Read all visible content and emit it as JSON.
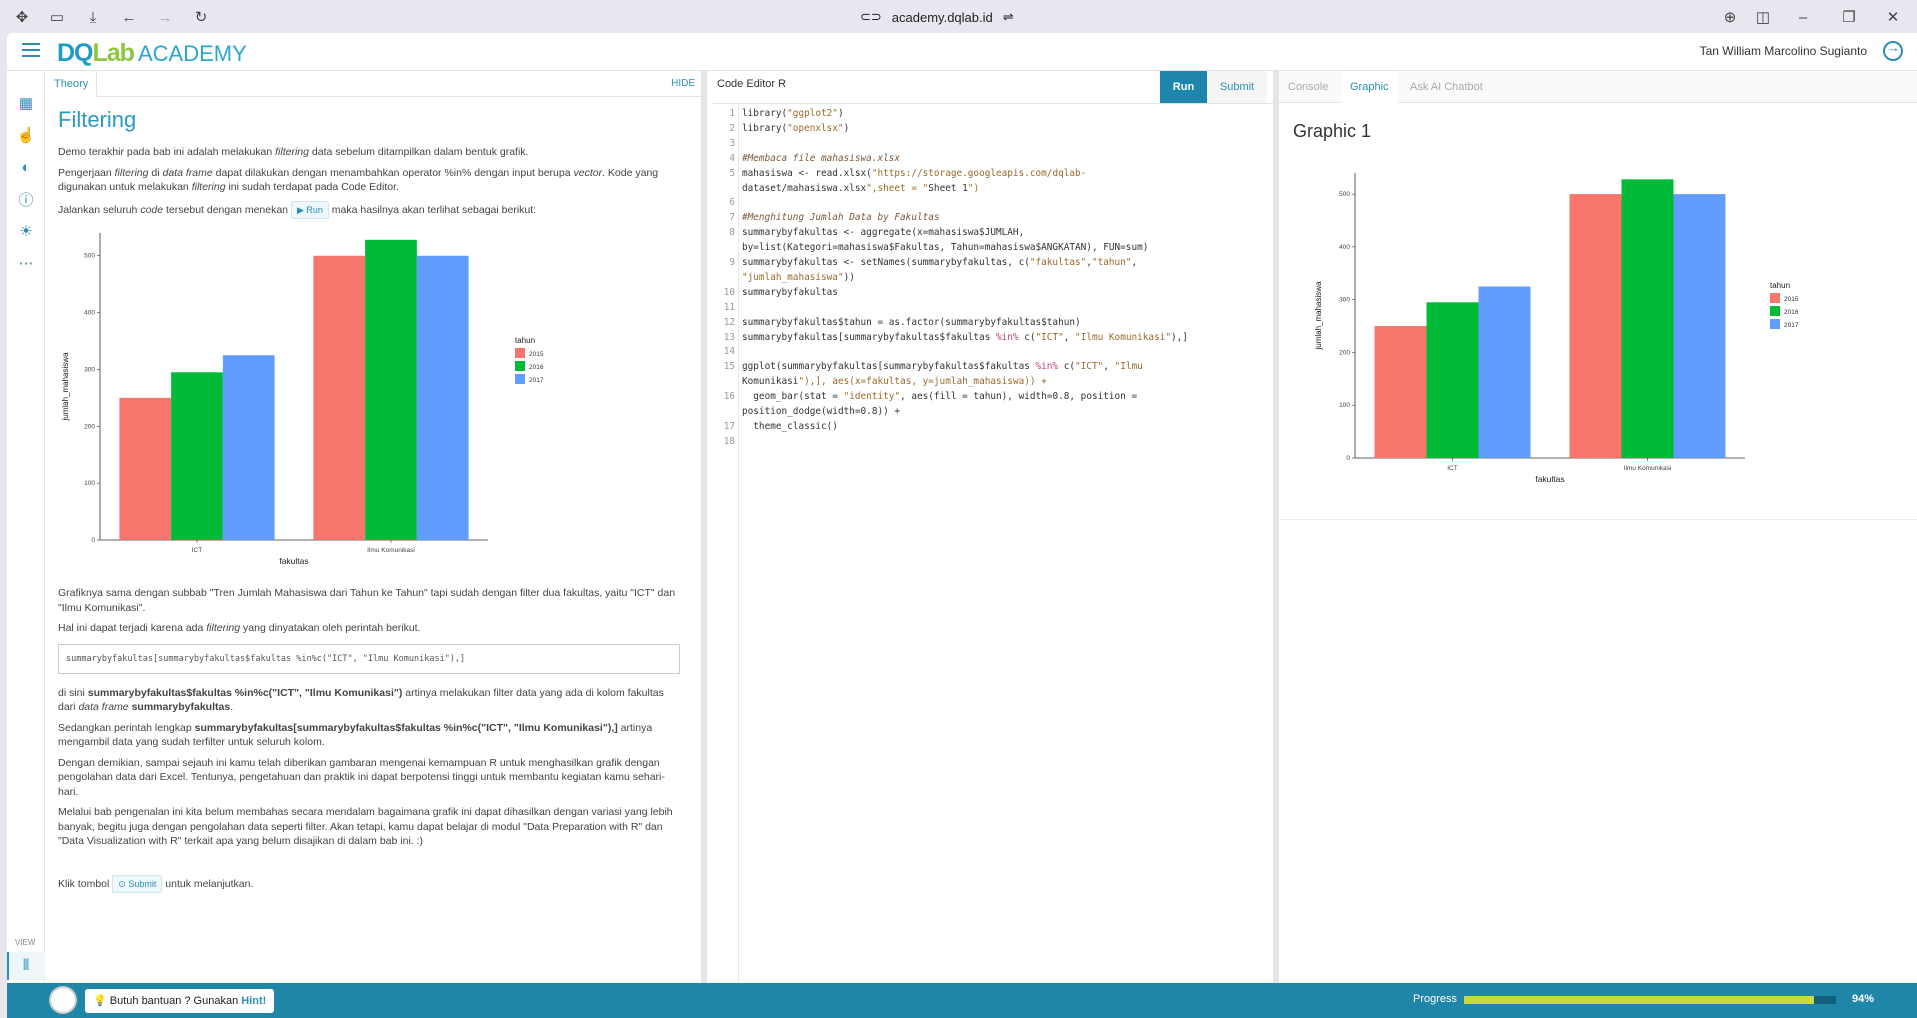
{
  "browser": {
    "url": "academy.dqlab.id"
  },
  "header": {
    "logo_dq": "DQ",
    "logo_lab": "Lab",
    "logo_academy": "ACADEMY",
    "user_name": "Tan William Marcolino Sugianto"
  },
  "rail": {
    "view_label": "VIEW"
  },
  "theory": {
    "tab_label": "Theory",
    "hide_label": "HIDE",
    "title": "Filtering",
    "p1_a": "Demo terakhir pada bab ini adalah melakukan ",
    "p1_em": "filtering",
    "p1_b": " data sebelum ditampilkan dalam bentuk grafik.",
    "p2_a": "Pengerjaan ",
    "p2_em1": "filtering",
    "p2_b": " di ",
    "p2_em2": "data frame",
    "p2_c": " dapat dilakukan dengan menambahkan operator %in% dengan input berupa ",
    "p2_em3": "vector",
    "p2_d": ". Kode yang digunakan untuk melakukan ",
    "p2_em4": "filtering",
    "p2_e": " ini sudah terdapat pada Code Editor.",
    "p3_a": "Jalankan seluruh ",
    "p3_em": "code",
    "p3_b": " tersebut dengan menekan ",
    "p3_btn": "Run",
    "p3_c": " maka hasilnya akan terlihat sebagai berikut:",
    "p4": "Grafiknya sama dengan subbab \"Tren Jumlah Mahasiswa dari Tahun ke Tahun\" tapi sudah dengan filter dua fakultas, yaitu \"ICT\" dan \"Ilmu Komunikasi\".",
    "p5_a": "Hal ini dapat terjadi karena ada ",
    "p5_em": "filtering",
    "p5_b": " yang dinyatakan oleh perintah berikut.",
    "code_snippet": "summarybyfakultas[summarybyfakultas$fakultas %in%c(\"ICT\", \"Ilmu Komunikasi\"),]",
    "p6_a": "di sini ",
    "p6_b1": "summarybyfakultas$fakultas %in%c(\"ICT\", \"Ilmu Komunikasi\")",
    "p6_c": " artinya melakukan filter data yang ada di kolom fakultas dari ",
    "p6_em": "data frame",
    "p6_d": " ",
    "p6_b2": "summarybyfakultas",
    "p6_e": ".",
    "p7_a": "Sedangkan perintah lengkap ",
    "p7_b": "summarybyfakultas[summarybyfakultas$fakultas %in%c(\"ICT\", \"Ilmu Komunikasi\"),]",
    "p7_c": " artinya mengambil data yang sudah terfilter untuk seluruh kolom.",
    "p8": "Dengan demikian, sampai sejauh ini kamu telah diberikan gambaran mengenai kemampuan R untuk menghasilkan grafik dengan pengolahan data dari Excel. Tentunya, pengetahuan dan praktik ini dapat berpotensi tinggi untuk membantu kegiatan kamu sehari-hari.",
    "p9": "Melalui bab pengenalan ini kita belum membahas secara mendalam bagaimana grafik ini dapat dihasilkan dengan variasi yang lebih banyak, begitu juga dengan pengolahan data seperti filter. Akan tetapi, kamu dapat belajar di modul \"Data Preparation with R\" dan \"Data Visualization with R\" terkait apa yang belum disajikan di dalam bab ini. :)",
    "p10_a": "Klik tombol ",
    "p10_btn": "Submit",
    "p10_b": " untuk melanjutkan."
  },
  "editor": {
    "tab_label": "Code Editor R",
    "run_label": "Run",
    "submit_label": "Submit",
    "lines": [
      {
        "n": "1",
        "t": "library(\"ggplot2\")"
      },
      {
        "n": "2",
        "t": "library(\"openxlsx\")"
      },
      {
        "n": "3",
        "t": ""
      },
      {
        "n": "4",
        "t": "#Membaca file mahasiswa.xlsx"
      },
      {
        "n": "5",
        "t": "mahasiswa <- read.xlsx(\"https://storage.googleapis.com/dqlab-"
      },
      {
        "n": "",
        "t": "dataset/mahasiswa.xlsx\",sheet = \"Sheet 1\")"
      },
      {
        "n": "6",
        "t": ""
      },
      {
        "n": "7",
        "t": "#Menghitung Jumlah Data by Fakultas"
      },
      {
        "n": "8",
        "t": "summarybyfakultas <- aggregate(x=mahasiswa$JUMLAH,"
      },
      {
        "n": "",
        "t": "by=list(Kategori=mahasiswa$Fakultas, Tahun=mahasiswa$ANGKATAN), FUN=sum)"
      },
      {
        "n": "9",
        "t": "summarybyfakultas <- setNames(summarybyfakultas, c(\"fakultas\",\"tahun\","
      },
      {
        "n": "",
        "t": "\"jumlah_mahasiswa\"))"
      },
      {
        "n": "10",
        "t": "summarybyfakultas"
      },
      {
        "n": "11",
        "t": ""
      },
      {
        "n": "12",
        "t": "summarybyfakultas$tahun = as.factor(summarybyfakultas$tahun)"
      },
      {
        "n": "13",
        "t": "summarybyfakultas[summarybyfakultas$fakultas %in% c(\"ICT\", \"Ilmu Komunikasi\"),]"
      },
      {
        "n": "14",
        "t": ""
      },
      {
        "n": "15",
        "t": "ggplot(summarybyfakultas[summarybyfakultas$fakultas %in% c(\"ICT\", \"Ilmu"
      },
      {
        "n": "",
        "t": "Komunikasi\"),], aes(x=fakultas, y=jumlah_mahasiswa)) +"
      },
      {
        "n": "16",
        "t": "  geom_bar(stat = \"identity\", aes(fill = tahun), width=0.8, position ="
      },
      {
        "n": "",
        "t": "position_dodge(width=0.8)) +"
      },
      {
        "n": "17",
        "t": "  theme_classic()"
      },
      {
        "n": "18",
        "t": ""
      }
    ]
  },
  "output": {
    "tabs": [
      "Console",
      "Graphic",
      "Ask AI Chatbot"
    ],
    "active_tab": "Graphic",
    "graphic_title": "Graphic 1"
  },
  "footer": {
    "hint_prefix": "Butuh bantuan ? Gunakan ",
    "hint_bold": "Hint!",
    "progress_label": "Progress",
    "progress_value": 0.94,
    "progress_text": "94%"
  },
  "colors": {
    "accent": "#1e86ad",
    "footer": "#1f86a8",
    "s2015": "#f8766d",
    "s2016": "#00ba38",
    "s2017": "#619cff"
  },
  "chart_data": [
    {
      "type": "bar",
      "categories": [
        "ICT",
        "Ilmu Komunikasi"
      ],
      "series": [
        {
          "name": "2015",
          "values": [
            250,
            500
          ]
        },
        {
          "name": "2016",
          "values": [
            295,
            528
          ]
        },
        {
          "name": "2017",
          "values": [
            325,
            500
          ]
        }
      ],
      "xlabel": "fakultas",
      "ylabel": "jumlah_mahasiswa",
      "legend_title": "tahun",
      "yticks": [
        0,
        100,
        200,
        300,
        400,
        500
      ],
      "ylim": [
        0,
        540
      ],
      "legend_position": "right"
    },
    {
      "type": "bar",
      "categories": [
        "ICT",
        "Ilmu Komunikasi"
      ],
      "series": [
        {
          "name": "2015",
          "values": [
            250,
            500
          ]
        },
        {
          "name": "2016",
          "values": [
            295,
            528
          ]
        },
        {
          "name": "2017",
          "values": [
            325,
            500
          ]
        }
      ],
      "xlabel": "fakultas",
      "ylabel": "jumlah_mahasiswa",
      "legend_title": "tahun",
      "yticks": [
        0,
        100,
        200,
        300,
        400,
        500
      ],
      "ylim": [
        0,
        540
      ],
      "legend_position": "right"
    }
  ]
}
